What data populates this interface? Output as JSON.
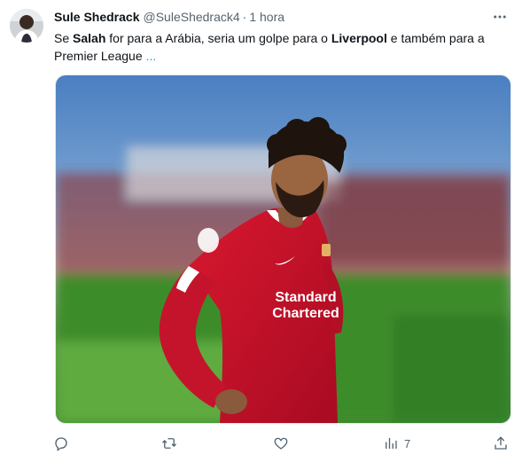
{
  "tweet": {
    "author_name": "Sule Shedrack",
    "handle": "@SuleShedrack4",
    "separator": "·",
    "time": "1 hora",
    "text_parts": {
      "p1": "Se ",
      "b1": "Salah",
      "p2": " for para a Arábia, seria um golpe para o ",
      "b2": "Liverpool",
      "p3": " e também para a Premier League",
      "more": "..."
    },
    "media": {
      "alt": "Mohamed Salah in red Liverpool kit, head bowed, hands on hips",
      "shirt_sponsor_line1": "Standard",
      "shirt_sponsor_line2": "Chartered"
    }
  },
  "actions": {
    "views_count": "7"
  },
  "icons": {
    "more": "more-horizontal-icon",
    "reply": "reply-icon",
    "retweet": "retweet-icon",
    "like": "heart-icon",
    "views": "views-bar-chart-icon",
    "share": "share-icon"
  },
  "colors": {
    "text": "#0f1419",
    "secondary": "#536471",
    "link": "#1d9bf0",
    "shirt_red": "#c8102e"
  }
}
